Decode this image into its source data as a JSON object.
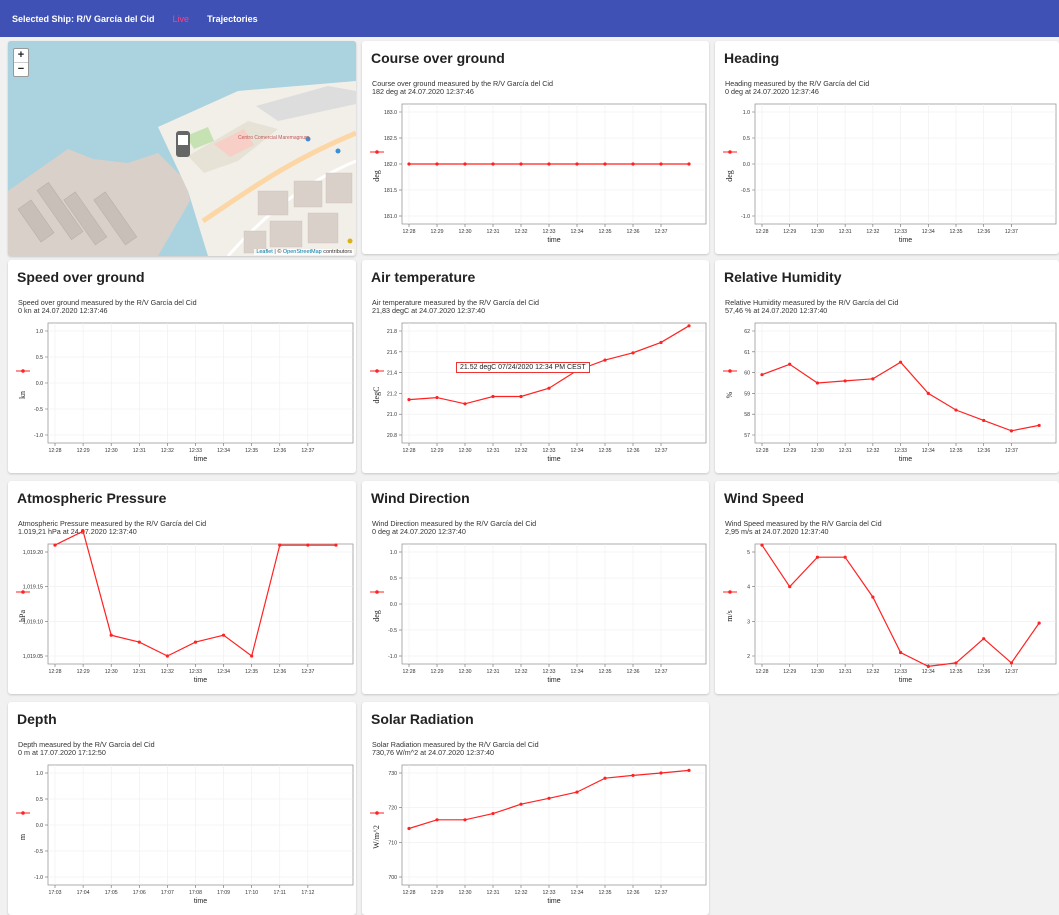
{
  "appbar": {
    "selected": "Selected Ship: R/V García del Cid",
    "live": "Live",
    "trajectories": "Trajectories"
  },
  "map": {
    "zoom_in": "+",
    "zoom_out": "−",
    "leaflet": "Leaflet",
    "sep": " | © ",
    "osm": "OpenStreetMap",
    "contributors": " contributors",
    "label_centro": "Centro Comercial Maremagnum"
  },
  "time_label": "time",
  "times_a": [
    "12:28",
    "12:29",
    "12:30",
    "12:31",
    "12:32",
    "12:33",
    "12:34",
    "12:35",
    "12:36",
    "12:37"
  ],
  "times_depth": [
    "17:03",
    "17:04",
    "17:05",
    "17:06",
    "17:07",
    "17:08",
    "17:09",
    "17:10",
    "17:11",
    "17:12"
  ],
  "colors": {
    "series": "#ff2222",
    "appbar": "#3f51b5",
    "live": "#ff4081"
  },
  "tooltip": "21.52 degC 07/24/2020 12:34 PM CEST",
  "cards": [
    {
      "id": "cog",
      "title": "Course over ground",
      "sub1": "Course over ground measured by the R/V García del Cid",
      "sub2": "182 deg at 24.07.2020 12:37:46",
      "unit": "deg",
      "yticks": [
        "183.0",
        "182.5",
        "182.0",
        "181.5",
        "181.0"
      ],
      "ymin": 181.0,
      "ymax": 183.0,
      "times": "a",
      "values": [
        182,
        182,
        182,
        182,
        182,
        182,
        182,
        182,
        182,
        182,
        182
      ]
    },
    {
      "id": "heading",
      "title": "Heading",
      "sub1": "Heading measured by the R/V García del Cid",
      "sub2": "0 deg at 24.07.2020 12:37:46",
      "unit": "deg",
      "yticks": [
        "1.0",
        "0.5",
        "0.0",
        "-0.5",
        "-1.0"
      ],
      "ymin": -1,
      "ymax": 1,
      "times": "a",
      "values": []
    },
    {
      "id": "sog",
      "title": "Speed over ground",
      "sub1": "Speed over ground measured by the R/V García del Cid",
      "sub2": "0 kn at 24.07.2020 12:37:46",
      "unit": "kn",
      "yticks": [
        "1.0",
        "0.5",
        "0.0",
        "-0.5",
        "-1.0"
      ],
      "ymin": -1,
      "ymax": 1,
      "times": "a",
      "values": []
    },
    {
      "id": "air",
      "title": "Air temperature",
      "sub1": "Air temperature measured by the R/V García del Cid",
      "sub2": "21,83 degC at 24.07.2020 12:37:40",
      "unit": "degC",
      "yticks": [
        "21.8",
        "21.6",
        "21.4",
        "21.2",
        "21.0",
        "20.8"
      ],
      "ymin": 20.8,
      "ymax": 21.8,
      "times": "a",
      "values": [
        21.14,
        21.16,
        21.1,
        21.17,
        21.17,
        21.25,
        21.42,
        21.52,
        21.59,
        21.69,
        21.85
      ]
    },
    {
      "id": "rh",
      "title": "Relative Humidity",
      "sub1": "Relative Humidity measured by the R/V García del Cid",
      "sub2": "57,46 % at 24.07.2020 12:37:40",
      "unit": "%",
      "yticks": [
        "62",
        "61",
        "60",
        "59",
        "58",
        "57"
      ],
      "ymin": 57,
      "ymax": 62,
      "times": "a",
      "values": [
        59.9,
        60.4,
        59.5,
        59.6,
        59.7,
        60.5,
        59.0,
        58.2,
        57.7,
        57.2,
        57.46
      ]
    },
    {
      "id": "press",
      "title": "Atmospheric Pressure",
      "sub1": "Atmospheric Pressure measured by the R/V García del Cid",
      "sub2": "1.019,21 hPa at 24.07.2020 12:37:40",
      "unit": "hPa",
      "yticks": [
        "1,019.20",
        "1,019.15",
        "1,019.10",
        "1,019.05"
      ],
      "ymin": 1019.05,
      "ymax": 1019.2,
      "times": "a",
      "values": [
        1019.21,
        1019.23,
        1019.08,
        1019.07,
        1019.05,
        1019.07,
        1019.08,
        1019.05,
        1019.21,
        1019.21,
        1019.21
      ]
    },
    {
      "id": "wdir",
      "title": "Wind Direction",
      "sub1": "Wind Direction measured by the R/V García del Cid",
      "sub2": "0 deg at 24.07.2020 12:37:40",
      "unit": "deg",
      "yticks": [
        "1.0",
        "0.5",
        "0.0",
        "-0.5",
        "-1.0"
      ],
      "ymin": -1,
      "ymax": 1,
      "times": "a",
      "values": []
    },
    {
      "id": "wspd",
      "title": "Wind Speed",
      "sub1": "Wind Speed measured by the R/V García del Cid",
      "sub2": "2,95 m/s at 24.07.2020 12:37:40",
      "unit": "m/s",
      "yticks": [
        "5",
        "4",
        "3",
        "2"
      ],
      "ymin": 2,
      "ymax": 5,
      "times": "a",
      "values": [
        5.2,
        4.0,
        4.85,
        4.85,
        3.7,
        2.1,
        1.7,
        1.8,
        2.5,
        1.8,
        2.95
      ]
    },
    {
      "id": "depth",
      "title": "Depth",
      "sub1": "Depth measured by the R/V García del Cid",
      "sub2": "0 m at 17.07.2020 17:12:50",
      "unit": "m",
      "yticks": [
        "1.0",
        "0.5",
        "0.0",
        "-0.5",
        "-1.0"
      ],
      "ymin": -1,
      "ymax": 1,
      "times": "depth",
      "values": []
    },
    {
      "id": "solar",
      "title": "Solar Radiation",
      "sub1": "Solar Radiation measured by the R/V García del Cid",
      "sub2": "730,76 W/m^2 at 24.07.2020 12:37:40",
      "unit": "W/m^2",
      "yticks": [
        "730",
        "720",
        "710",
        "700"
      ],
      "ymin": 700,
      "ymax": 730,
      "times": "a",
      "values": [
        714,
        716.5,
        716.5,
        718.3,
        721,
        722.7,
        724.5,
        728.5,
        729.3,
        730,
        730.76
      ]
    }
  ]
}
